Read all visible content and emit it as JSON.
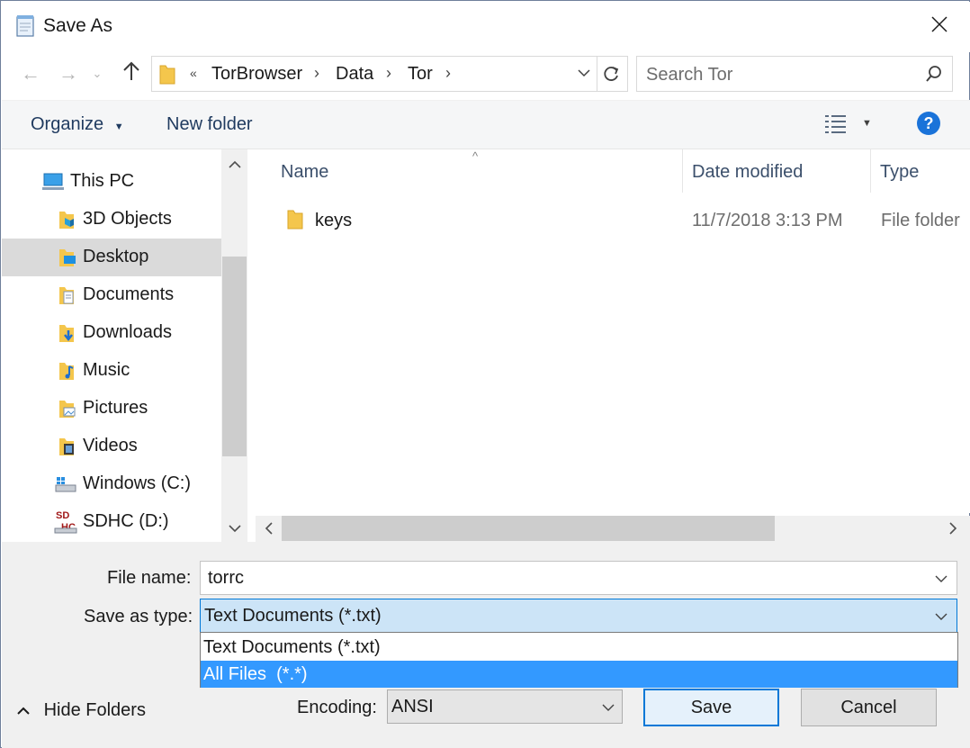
{
  "window": {
    "title": "Save As"
  },
  "nav": {
    "breadcrumb": [
      "TorBrowser",
      "Data",
      "Tor"
    ],
    "overflow": "«"
  },
  "search": {
    "placeholder": "Search Tor"
  },
  "toolbar": {
    "organize": "Organize",
    "new_folder": "New folder"
  },
  "sidebar": {
    "items": [
      {
        "label": "This PC",
        "icon": "pc-icon"
      },
      {
        "label": "3D Objects",
        "icon": "3d-objects-icon"
      },
      {
        "label": "Desktop",
        "icon": "desktop-icon",
        "selected": true
      },
      {
        "label": "Documents",
        "icon": "documents-icon"
      },
      {
        "label": "Downloads",
        "icon": "downloads-icon"
      },
      {
        "label": "Music",
        "icon": "music-icon"
      },
      {
        "label": "Pictures",
        "icon": "pictures-icon"
      },
      {
        "label": "Videos",
        "icon": "videos-icon"
      },
      {
        "label": "Windows (C:)",
        "icon": "drive-icon"
      },
      {
        "label": "SDHC (D:)",
        "icon": "sd-card-icon"
      }
    ]
  },
  "file_list": {
    "columns": [
      "Name",
      "Date modified",
      "Type"
    ],
    "rows": [
      {
        "name": "keys",
        "date": "11/7/2018 3:13 PM",
        "type": "File folder"
      }
    ]
  },
  "form": {
    "file_name_label": "File name:",
    "file_name": "torrc",
    "type_label": "Save as type:",
    "type_value": "Text Documents (*.txt)",
    "type_options": [
      "Text Documents (*.txt)",
      "All Files  (*.*)"
    ],
    "highlighted_option": 1,
    "encoding_label": "Encoding:",
    "encoding": "ANSI"
  },
  "buttons": {
    "hide_folders": "Hide Folders",
    "save": "Save",
    "cancel": "Cancel"
  },
  "colors": {
    "accent": "#0078d7",
    "highlight": "#3399ff",
    "selection": "#cce4f7",
    "help": "#1a73d9"
  }
}
